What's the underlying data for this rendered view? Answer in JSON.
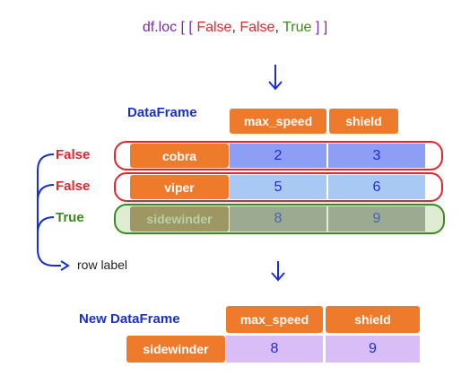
{
  "code_line": {
    "prefix": "df.loc [ [ ",
    "v1": "False",
    "sep1": ", ",
    "v2": "False",
    "sep2": ", ",
    "v3": "True",
    "suffix": " ] ]"
  },
  "dataframe": {
    "caption": "DataFrame",
    "columns": [
      "max_speed",
      "shield"
    ],
    "rows": [
      {
        "selector": "False",
        "index": "cobra",
        "values": [
          "2",
          "3"
        ]
      },
      {
        "selector": "False",
        "index": "viper",
        "values": [
          "5",
          "6"
        ]
      },
      {
        "selector": "True",
        "index": "sidewinder",
        "values": [
          "8",
          "9"
        ]
      }
    ]
  },
  "row_label_note": "row label",
  "new_dataframe": {
    "caption": "New DataFrame",
    "columns": [
      "max_speed",
      "shield"
    ],
    "rows": [
      {
        "index": "sidewinder",
        "values": [
          "8",
          "9"
        ]
      }
    ]
  },
  "colors": {
    "orange": "#ee7a2c",
    "blue_cell": "#8f9ef5",
    "lightblue_cell": "#a9c9f5",
    "gray_cell": "#9a9a9a",
    "lavender_cell": "#d8bdf6",
    "red": "#e0262e",
    "green": "#3c8a1f",
    "blue_text": "#1a2fd0"
  }
}
